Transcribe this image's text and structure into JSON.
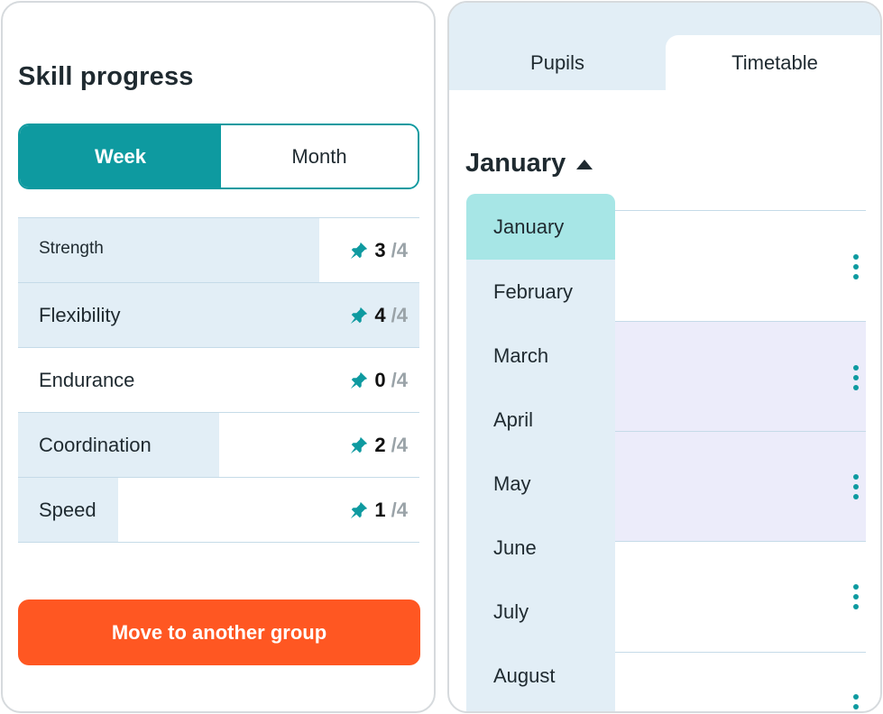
{
  "skill_panel": {
    "title": "Skill progress",
    "toggle": {
      "week": "Week",
      "month": "Month",
      "selected": "Week"
    },
    "max_label": "/4",
    "skills": [
      {
        "name": "Strength",
        "score": "3",
        "max": "/4",
        "fill": 0.75
      },
      {
        "name": "Flexibility",
        "score": "4",
        "max": "/4",
        "fill": 1.0
      },
      {
        "name": "Endurance",
        "score": "0",
        "max": "/4",
        "fill": 0.0
      },
      {
        "name": "Coordination",
        "score": "2",
        "max": "/4",
        "fill": 0.5
      },
      {
        "name": "Speed",
        "score": "1",
        "max": "/4",
        "fill": 0.25
      }
    ],
    "move_button": "Move to another group"
  },
  "timetable_panel": {
    "tabs": {
      "pupils": "Pupils",
      "timetable": "Timetable",
      "active": "Timetable"
    },
    "month_selector": "January",
    "months": [
      "January",
      "February",
      "March",
      "April",
      "May",
      "June",
      "July",
      "August"
    ],
    "selected_month": "January"
  },
  "colors": {
    "accent": "#0e9aa0",
    "button": "#ff5722",
    "row_fill": "#e2eef6",
    "row_highlight": "#ececfa",
    "selected_month": "#a7e6e6"
  }
}
